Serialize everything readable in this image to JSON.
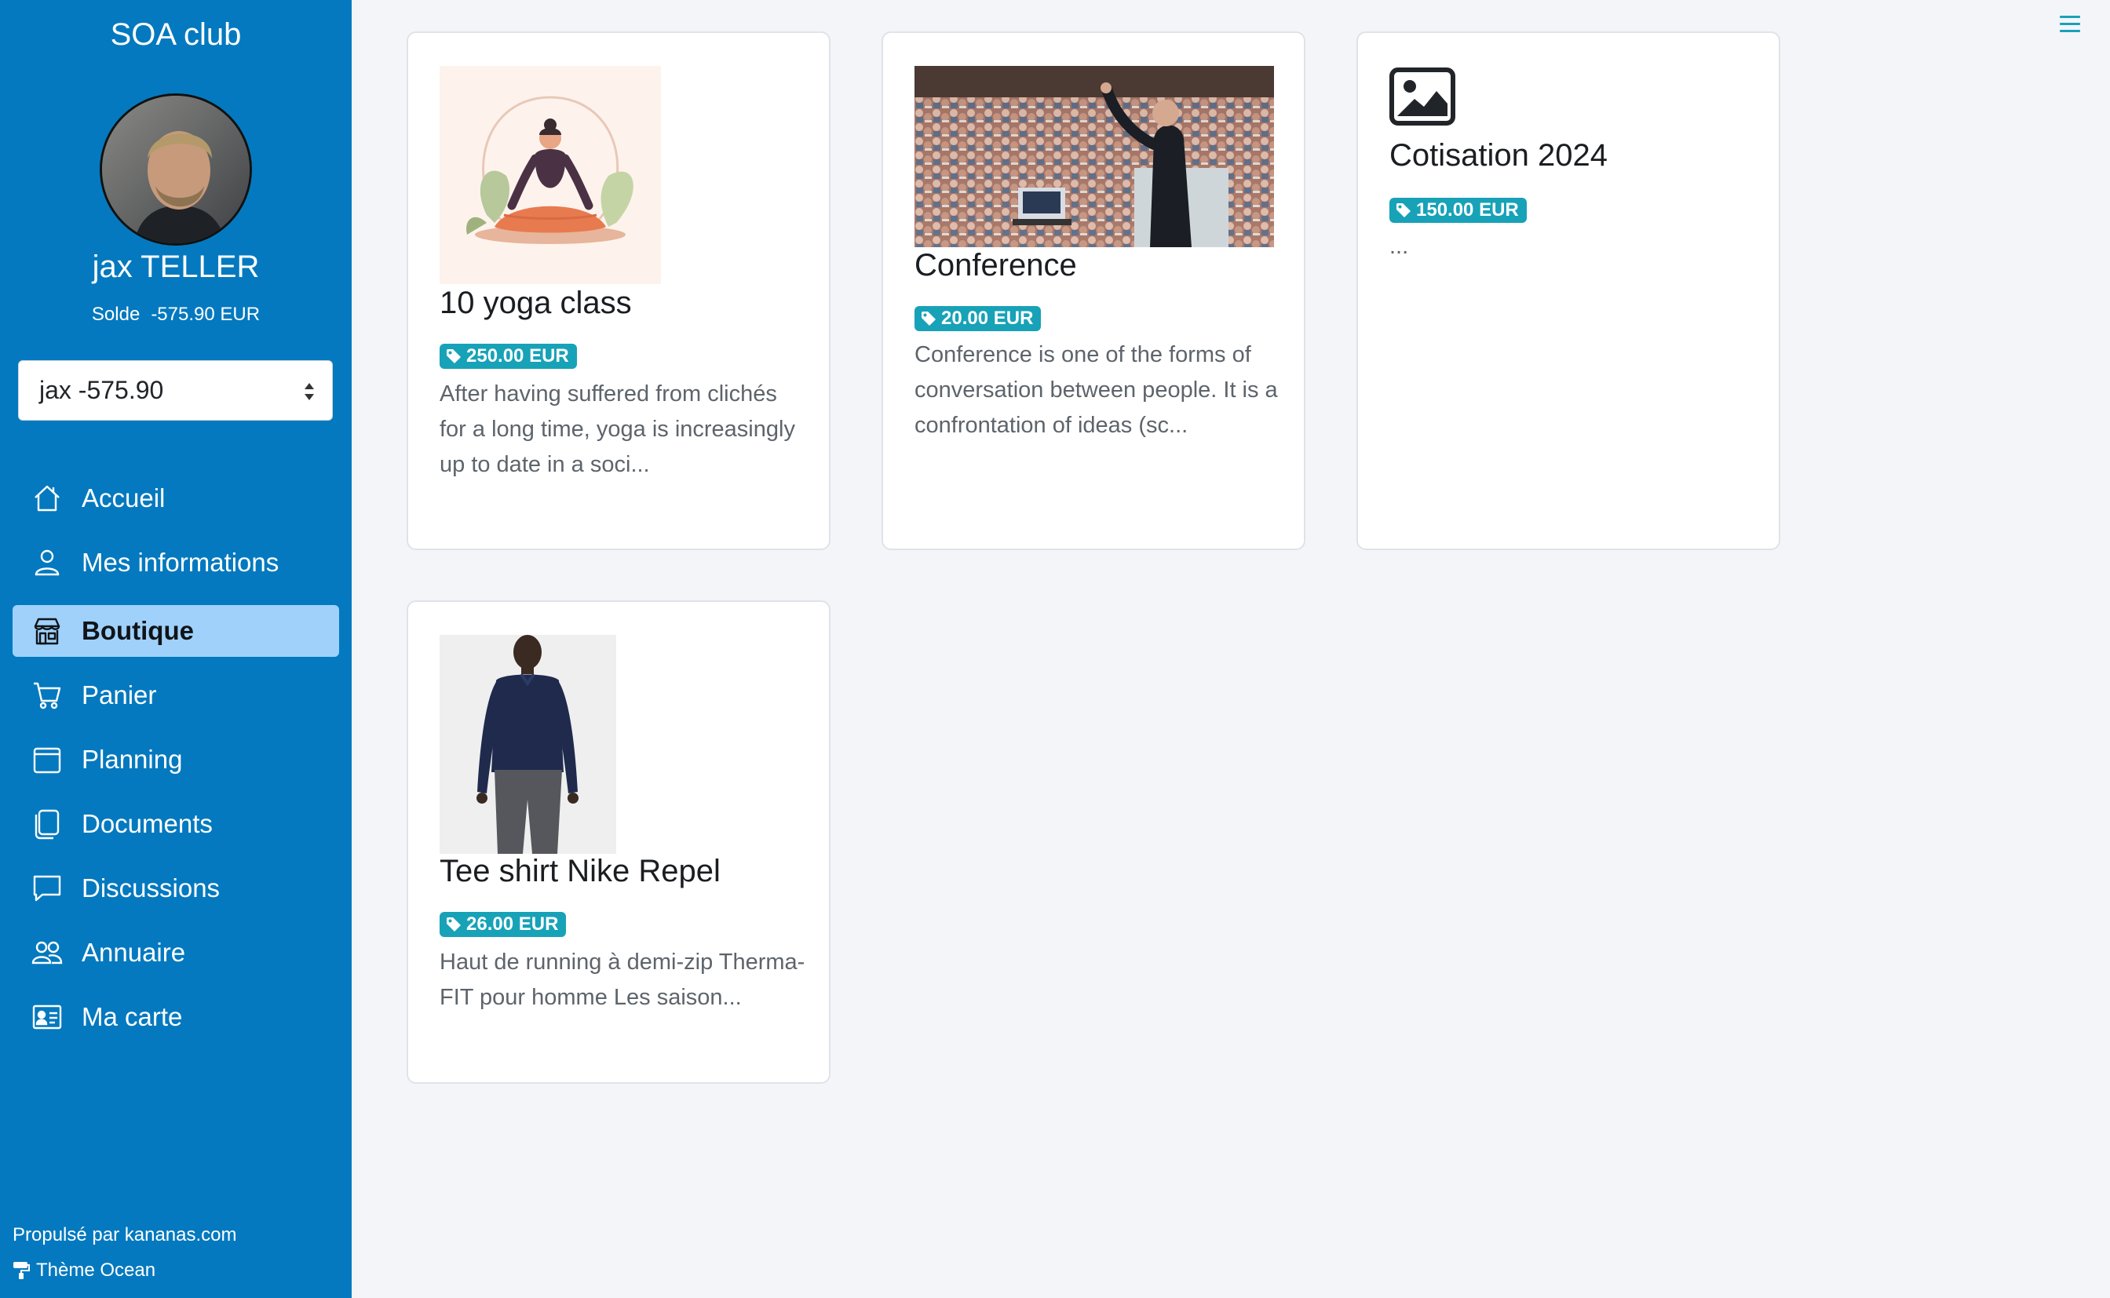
{
  "sidebar": {
    "club_name": "SOA club",
    "user_name": "jax TELLER",
    "balance_label": "Solde",
    "balance_value": "-575.90 EUR",
    "account_select_value": "jax -575.90",
    "nav": [
      {
        "label": "Accueil",
        "icon": "home-icon"
      },
      {
        "label": "Mes informations",
        "icon": "person-icon"
      },
      {
        "label": "Boutique",
        "icon": "shop-icon",
        "active": true
      },
      {
        "label": "Panier",
        "icon": "cart-icon"
      },
      {
        "label": "Planning",
        "icon": "calendar-icon"
      },
      {
        "label": "Documents",
        "icon": "documents-icon"
      },
      {
        "label": "Discussions",
        "icon": "chat-icon"
      },
      {
        "label": "Annuaire",
        "icon": "people-icon"
      },
      {
        "label": "Ma carte",
        "icon": "card-icon"
      }
    ],
    "powered_by": "Propulsé par kananas.com",
    "theme": "Thème Ocean"
  },
  "products": [
    {
      "title": "10 yoga class",
      "price": "250.00 EUR",
      "description": "After having suffered from clichés for a long time, yoga is increasingly up to date in a soci...",
      "image": "yoga-illustration"
    },
    {
      "title": "Conference",
      "price": "20.00 EUR",
      "description": "Conference is one of the forms of conversation between people. It is a confrontation of ideas (sc...",
      "image": "conference-photo"
    },
    {
      "title": "Cotisation 2024",
      "price": "150.00 EUR",
      "description": "...",
      "image": "image-placeholder-icon"
    },
    {
      "title": "Tee shirt Nike Repel",
      "price": "26.00 EUR",
      "description": "Haut de running à demi-zip Therma-FIT pour homme Les saison...",
      "image": "tshirt-photo"
    }
  ],
  "colors": {
    "sidebar_bg": "#0479bf",
    "active_nav_bg": "#9fd1fb",
    "badge_bg": "#17a2b8",
    "page_bg": "#f4f5f9"
  }
}
